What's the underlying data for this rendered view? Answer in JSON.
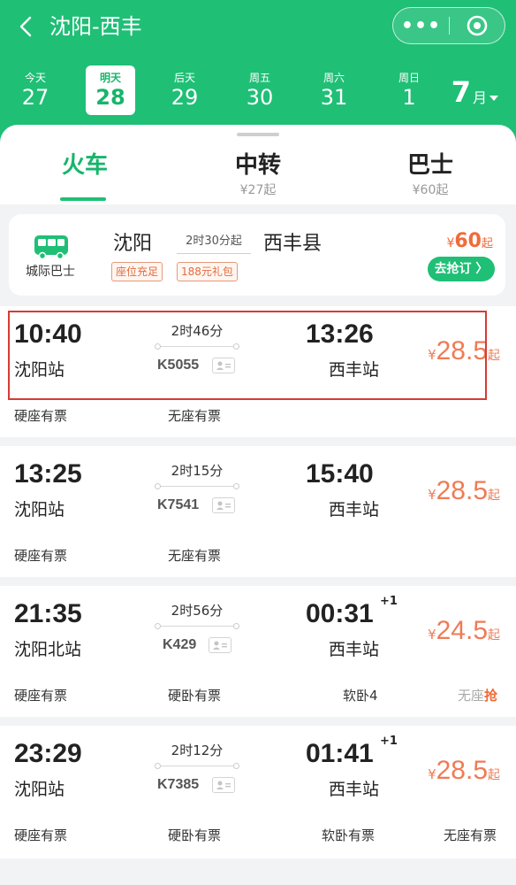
{
  "header": {
    "title": "沈阳-西丰",
    "more_glyph": "•••",
    "capsule_icons": [
      "more-dots-icon",
      "record-target-icon"
    ]
  },
  "dates": [
    {
      "label": "今天",
      "day": "27"
    },
    {
      "label": "明天",
      "day": "28",
      "active": true
    },
    {
      "label": "后天",
      "day": "29"
    },
    {
      "label": "周五",
      "day": "30"
    },
    {
      "label": "周六",
      "day": "31"
    },
    {
      "label": "周日",
      "day": "1"
    }
  ],
  "month": {
    "number": "7",
    "unit": "月"
  },
  "tabs": [
    {
      "label": "火车",
      "sub": "",
      "active": true
    },
    {
      "label": "中转",
      "sub": "¥27起"
    },
    {
      "label": "巴士",
      "sub": "¥60起"
    }
  ],
  "bus": {
    "type_label": "城际巴士",
    "from": "沈阳",
    "duration": "2时30分起",
    "to": "西丰县",
    "tags": [
      "座位充足",
      "188元礼包"
    ],
    "price_symbol": "¥",
    "price": "60",
    "price_suffix": "起",
    "button": "去抢订 〉"
  },
  "trains": [
    {
      "dep": "10:40",
      "dep_station": "沈阳站",
      "duration": "2时46分",
      "number": "K5055",
      "arr": "13:26",
      "arr_station": "西丰站",
      "plus_day": "",
      "price_symbol": "¥",
      "price": "28.5",
      "price_suffix": "起",
      "seats": [
        "硬座有票",
        "无座有票"
      ]
    },
    {
      "dep": "13:25",
      "dep_station": "沈阳站",
      "duration": "2时15分",
      "number": "K7541",
      "arr": "15:40",
      "arr_station": "西丰站",
      "plus_day": "",
      "price_symbol": "¥",
      "price": "28.5",
      "price_suffix": "起",
      "seats": [
        "硬座有票",
        "无座有票"
      ]
    },
    {
      "dep": "21:35",
      "dep_station": "沈阳北站",
      "duration": "2时56分",
      "number": "K429",
      "arr": "00:31",
      "arr_station": "西丰站",
      "plus_day": "+1",
      "price_symbol": "¥",
      "price": "24.5",
      "price_suffix": "起",
      "seats": [
        "硬座有票",
        "硬卧有票",
        "软卧4"
      ],
      "last_seat": {
        "text": "无座",
        "action": "抢"
      }
    },
    {
      "dep": "23:29",
      "dep_station": "沈阳站",
      "duration": "2时12分",
      "number": "K7385",
      "arr": "01:41",
      "arr_station": "西丰站",
      "plus_day": "+1",
      "price_symbol": "¥",
      "price": "28.5",
      "price_suffix": "起",
      "seats": [
        "硬座有票",
        "硬卧有票",
        "软卧有票",
        "无座有票"
      ]
    }
  ],
  "colors": {
    "brand": "#1fbf76",
    "price": "#ef7b55",
    "highlight": "#d63b36"
  }
}
